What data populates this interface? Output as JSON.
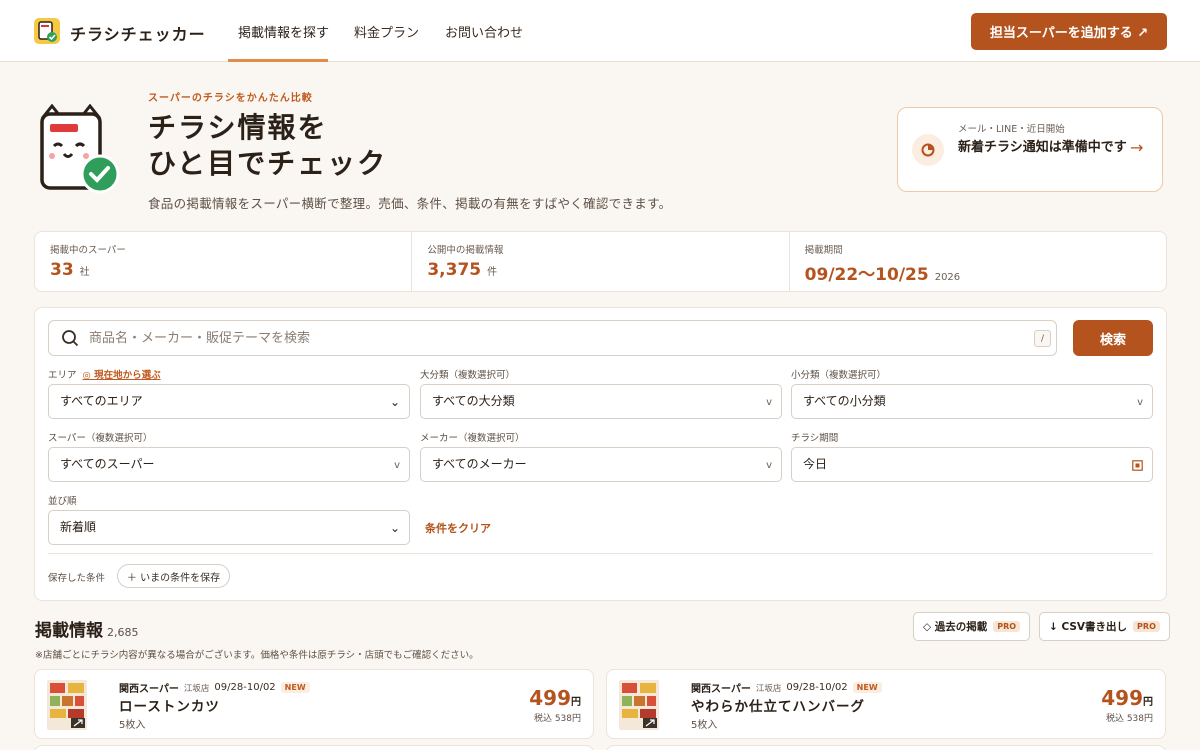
{
  "header": {
    "brand": "チラシチェッカー",
    "nav": [
      {
        "label": "掲載情報を探す"
      },
      {
        "label": "料金プラン"
      },
      {
        "label": "お問い合わせ"
      }
    ],
    "cta_label": "担当スーパーを追加する ↗"
  },
  "hero": {
    "eyebrow": "スーパーのチラシをかんたん比較",
    "title_line1": "チラシ情報を",
    "title_line2": "ひと目でチェック",
    "description": "食品の掲載情報をスーパー横断で整理。売価、条件、掲載の有無をすばやく確認できます。"
  },
  "notify": {
    "small": "メール・LINE・近日開始",
    "title": "新着チラシ通知は準備中です",
    "arrow": "→"
  },
  "stats": [
    {
      "label": "掲載中のスーパー",
      "value": "33",
      "unit": "社"
    },
    {
      "label": "公開中の掲載情報",
      "value": "3,375",
      "unit": "件"
    },
    {
      "label": "掲載期間",
      "value": "09/22〜10/25",
      "unit": "2026"
    }
  ],
  "search": {
    "placeholder": "商品名・メーカー・販促テーマを検索",
    "shortcut": "/",
    "button": "検索"
  },
  "filters": {
    "area": {
      "label": "エリア",
      "link": "◎ 現在地から選ぶ",
      "value": "すべてのエリア"
    },
    "major": {
      "label": "大分類（複数選択可）",
      "value": "すべての大分類"
    },
    "minor": {
      "label": "小分類（複数選択可）",
      "value": "すべての小分類"
    },
    "super": {
      "label": "スーパー（複数選択可）",
      "value": "すべてのスーパー"
    },
    "maker": {
      "label": "メーカー（複数選択可）",
      "value": "すべてのメーカー"
    },
    "period": {
      "label": "チラシ期間",
      "value": "今日"
    },
    "sort": {
      "label": "並び順",
      "value": "新着順"
    },
    "clear": "条件をクリア",
    "saved_label": "保存した条件",
    "save_button": "＋ いまの条件を保存"
  },
  "listings": {
    "title": "掲載情報",
    "count": "2,685",
    "note": "※店舗ごとにチラシ内容が異なる場合がございます。価格や条件は原チラシ・店頭でもご確認ください。",
    "past_button": "◇ 過去の掲載",
    "csv_button": "↓ CSV書き出し",
    "pro_badge": "PRO",
    "items": [
      {
        "store": "関西スーパー",
        "branch": "江坂店",
        "date": "09/28-10/02",
        "badge": "NEW",
        "name": "ローストンカツ",
        "qty": "5枚入",
        "price": "499",
        "yen": "円",
        "tax": "税込 538円"
      },
      {
        "store": "関西スーパー",
        "branch": "江坂店",
        "date": "09/28-10/02",
        "badge": "NEW",
        "name": "やわらか仕立てハンバーグ",
        "qty": "5枚入",
        "price": "499",
        "yen": "円",
        "tax": "税込 538円"
      }
    ]
  },
  "colors": {
    "accent": "#b4531d",
    "background": "#faf6f1",
    "highlight": "#e08c4a"
  }
}
